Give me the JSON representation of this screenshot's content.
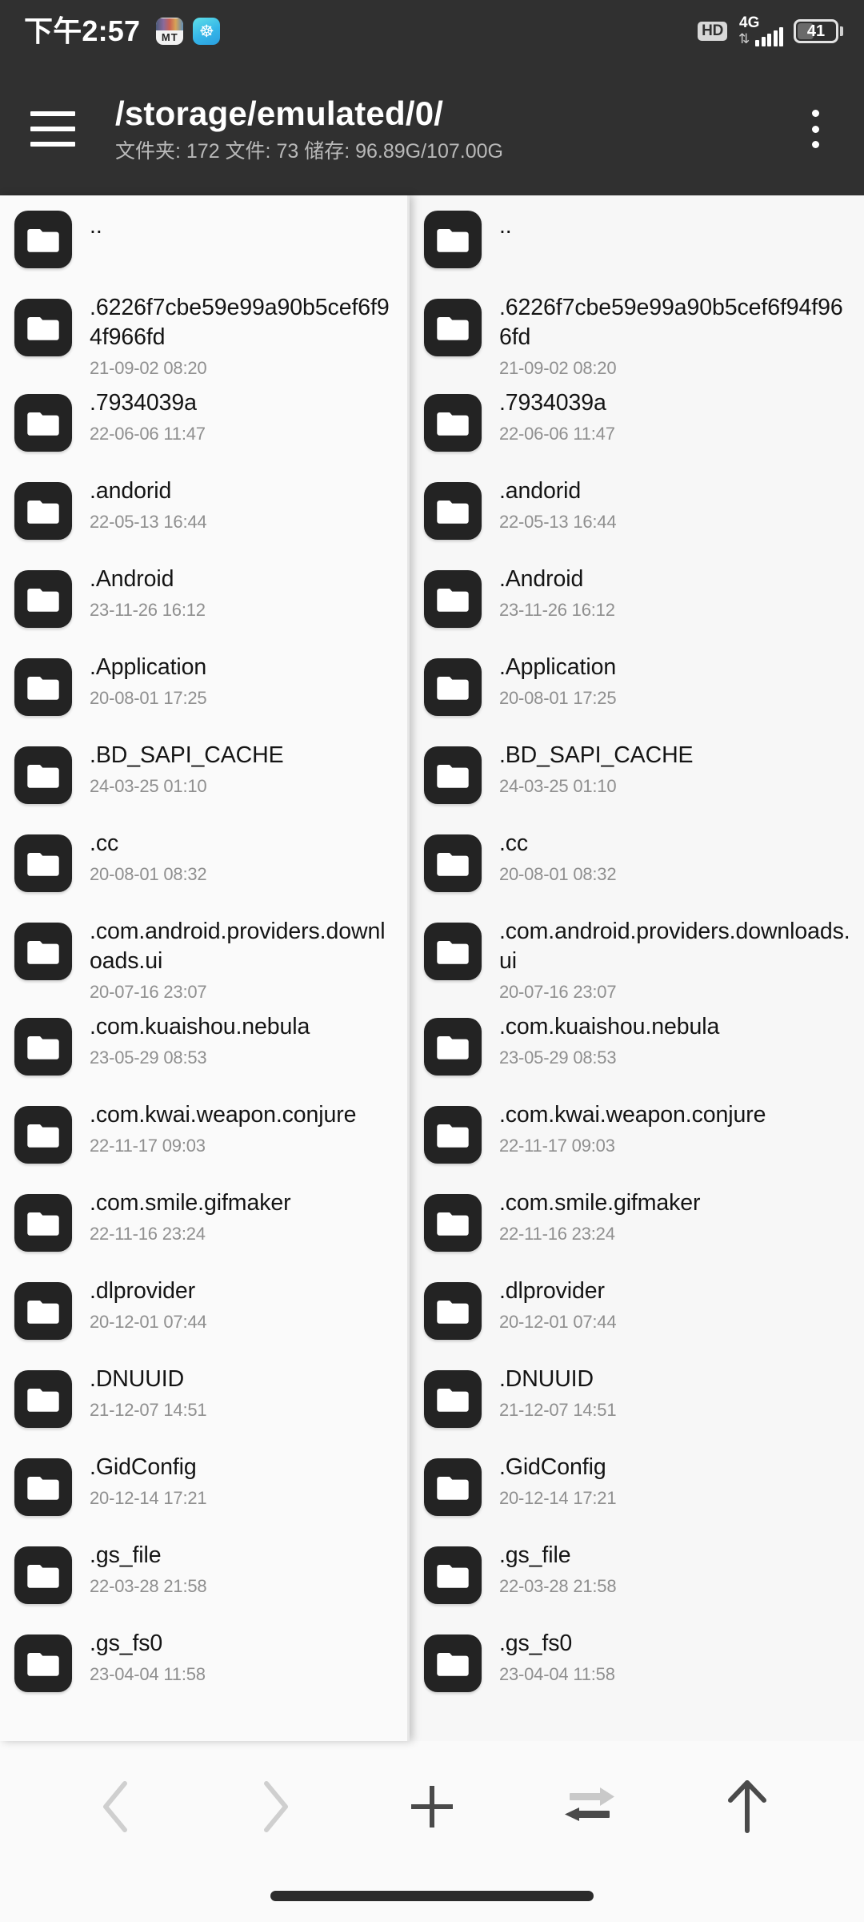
{
  "statusbar": {
    "time": "下午2:57",
    "notification_icons": [
      {
        "name": "mt-manager-icon",
        "label": "MT"
      },
      {
        "name": "blue-globe-icon",
        "label": "☸"
      }
    ],
    "hd_badge": "HD",
    "network_type": "4G",
    "data_arrows": "⇅",
    "signal_bars": 5,
    "battery_percent": "41"
  },
  "appbar": {
    "menu_icon": "hamburger-menu-icon",
    "title": "/storage/emulated/0/",
    "subtitle": "文件夹: 172  文件: 73  储存: 96.89G/107.00G",
    "overflow_icon": "more-vertical-icon"
  },
  "files": [
    {
      "name": "..",
      "date": "",
      "type": "folder"
    },
    {
      "name": ".6226f7cbe59e99a90b5cef6f94f966fd",
      "date": "21-09-02 08:20",
      "type": "folder"
    },
    {
      "name": ".7934039a",
      "date": "22-06-06 11:47",
      "type": "folder"
    },
    {
      "name": ".andorid",
      "date": "22-05-13 16:44",
      "type": "folder"
    },
    {
      "name": ".Android",
      "date": "23-11-26 16:12",
      "type": "folder"
    },
    {
      "name": ".Application",
      "date": "20-08-01 17:25",
      "type": "folder"
    },
    {
      "name": ".BD_SAPI_CACHE",
      "date": "24-03-25 01:10",
      "type": "folder"
    },
    {
      "name": ".cc",
      "date": "20-08-01 08:32",
      "type": "folder"
    },
    {
      "name": ".com.android.providers.downloads.ui",
      "date": "20-07-16 23:07",
      "type": "folder"
    },
    {
      "name": ".com.kuaishou.nebula",
      "date": "23-05-29 08:53",
      "type": "folder"
    },
    {
      "name": ".com.kwai.weapon.conjure",
      "date": "22-11-17 09:03",
      "type": "folder"
    },
    {
      "name": ".com.smile.gifmaker",
      "date": "22-11-16 23:24",
      "type": "folder"
    },
    {
      "name": ".dlprovider",
      "date": "20-12-01 07:44",
      "type": "folder"
    },
    {
      "name": ".DNUUID",
      "date": "21-12-07 14:51",
      "type": "folder"
    },
    {
      "name": ".GidConfig",
      "date": "20-12-14 17:21",
      "type": "folder"
    },
    {
      "name": ".gs_file",
      "date": "22-03-28 21:58",
      "type": "folder"
    },
    {
      "name": ".gs_fs0",
      "date": "23-04-04 11:58",
      "type": "folder"
    }
  ],
  "toolbar": [
    {
      "name": "back-button",
      "icon": "chevron-left-icon",
      "enabled": false
    },
    {
      "name": "forward-button",
      "icon": "chevron-right-icon",
      "enabled": false
    },
    {
      "name": "add-button",
      "icon": "plus-icon",
      "enabled": true
    },
    {
      "name": "swap-panels-button",
      "icon": "swap-arrows-icon",
      "enabled": true
    },
    {
      "name": "up-directory-button",
      "icon": "arrow-up-icon",
      "enabled": true
    }
  ],
  "colors": {
    "statusbar_bg": "#303030",
    "appbar_bg": "#303030",
    "panel_left_bg": "#fafafa",
    "panel_right_bg": "#f7f7f7",
    "icon_bg": "#232323",
    "filename": "#141414",
    "filedate": "#8f8f8f"
  }
}
